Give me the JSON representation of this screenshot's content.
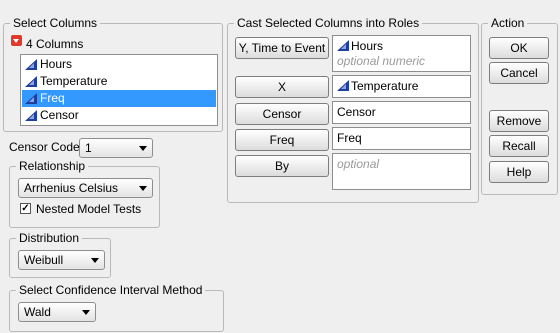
{
  "select_columns": {
    "title": "Select Columns",
    "count_label": "4 Columns",
    "items": [
      {
        "label": "Hours",
        "selected": false
      },
      {
        "label": "Temperature",
        "selected": false
      },
      {
        "label": "Freq",
        "selected": true
      },
      {
        "label": "Censor",
        "selected": false
      }
    ]
  },
  "censor_code": {
    "label": "Censor Code",
    "value": "1"
  },
  "relationship": {
    "title": "Relationship",
    "value": "Arrhenius Celsius",
    "nested_label": "Nested Model Tests",
    "nested_checked": true
  },
  "distribution": {
    "title": "Distribution",
    "value": "Weibull"
  },
  "ci_method": {
    "title": "Select Confidence Interval Method",
    "value": "Wald"
  },
  "cast_roles": {
    "title": "Cast Selected Columns into Roles",
    "roles": [
      {
        "button": "Y, Time to Event",
        "value": "Hours",
        "hint": "optional numeric"
      },
      {
        "button": "X",
        "value": "Temperature"
      },
      {
        "button": "Censor",
        "value": "Censor"
      },
      {
        "button": "Freq",
        "value": "Freq"
      },
      {
        "button": "By",
        "hint": "optional"
      }
    ]
  },
  "action": {
    "title": "Action",
    "ok": "OK",
    "cancel": "Cancel",
    "remove": "Remove",
    "recall": "Recall",
    "help": "Help"
  }
}
